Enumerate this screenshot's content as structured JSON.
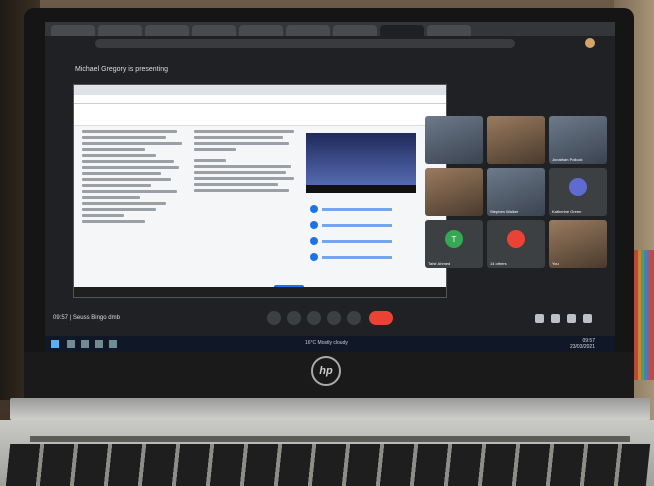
{
  "meet": {
    "presenting_label": "Michael Gregory is presenting",
    "meeting_info": "09:57  |  Seuss Bingo dmb"
  },
  "participants": [
    {
      "name": "",
      "kind": "camera"
    },
    {
      "name": "",
      "kind": "camera"
    },
    {
      "name": "Jonathan Pollock",
      "kind": "camera"
    },
    {
      "name": "",
      "kind": "camera"
    },
    {
      "name": "Stephen Walker",
      "kind": "camera"
    },
    {
      "name": "Katherine Green",
      "kind": "avatar"
    },
    {
      "name": "Tahir Ahmed",
      "kind": "initial",
      "initial": "T",
      "color": "#34a853"
    },
    {
      "name": "14 others",
      "kind": "others"
    },
    {
      "name": "You",
      "kind": "camera"
    }
  ],
  "taskbar": {
    "weather": "16°C  Mostly cloudy",
    "time": "09:57",
    "date": "23/03/2021"
  },
  "icons": [
    "mic-icon",
    "camera-icon",
    "hand-icon",
    "present-icon",
    "more-icon",
    "end-call-icon",
    "info-icon",
    "people-icon",
    "chat-icon",
    "activities-icon"
  ]
}
